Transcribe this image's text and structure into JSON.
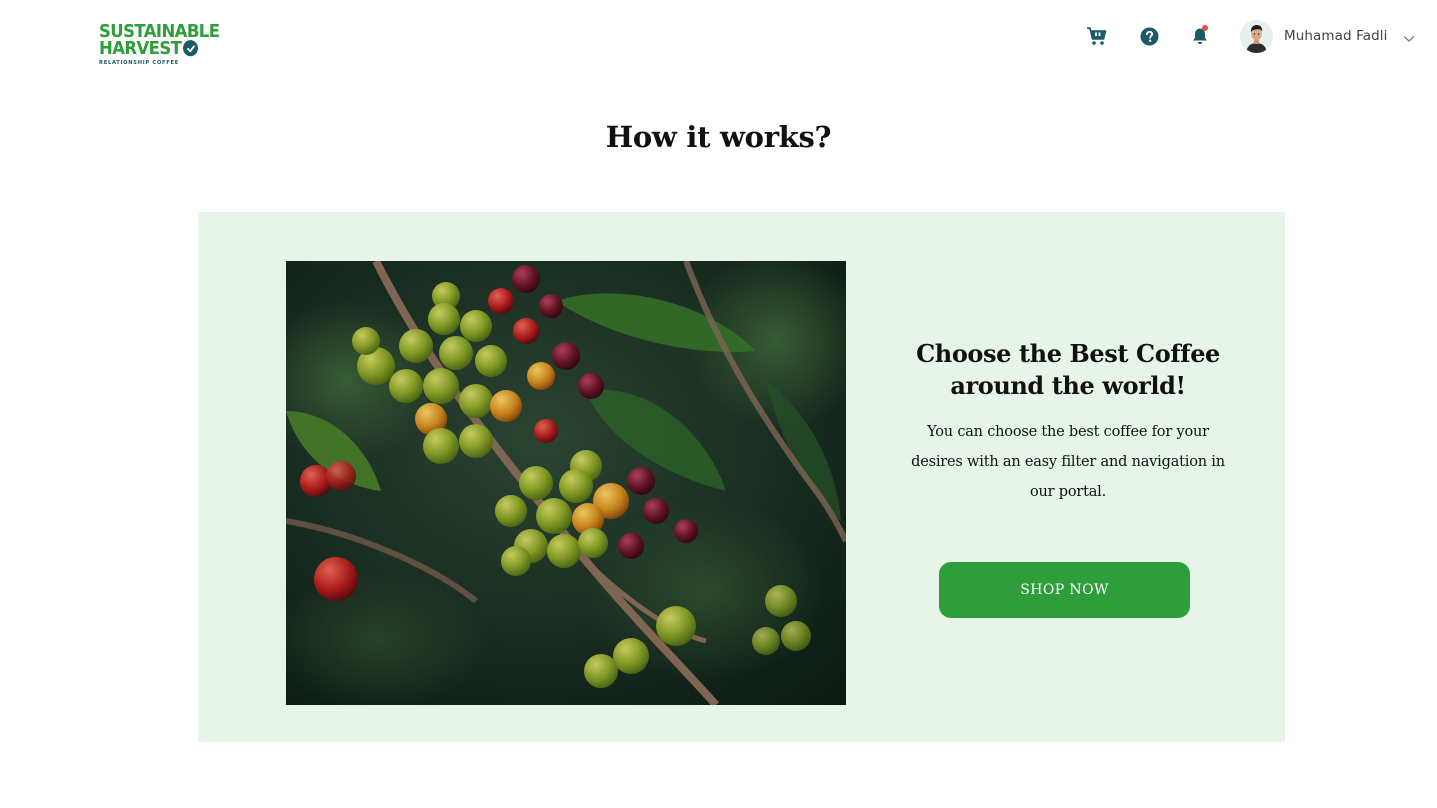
{
  "header": {
    "logo": {
      "line1": "SUSTAINABLE",
      "line2": "HARVEST",
      "line3": "RELATIONSHIP COFFEE"
    },
    "icons": [
      "cart-icon",
      "help-icon",
      "bell-icon"
    ],
    "user": {
      "name": "Muhamad Fadli"
    }
  },
  "main": {
    "section_title": "How it works?",
    "card": {
      "title": "Choose the Best Coffee around the world!",
      "description": "You can choose the best coffee for your desires with an easy filter and navigation in our portal.",
      "button_label": "SHOP NOW"
    }
  },
  "colors": {
    "brand_green": "#2e9e3a",
    "brand_teal": "#1c5a66",
    "panel_bg": "#e6f5e8",
    "notification_dot": "#e74c3c"
  }
}
